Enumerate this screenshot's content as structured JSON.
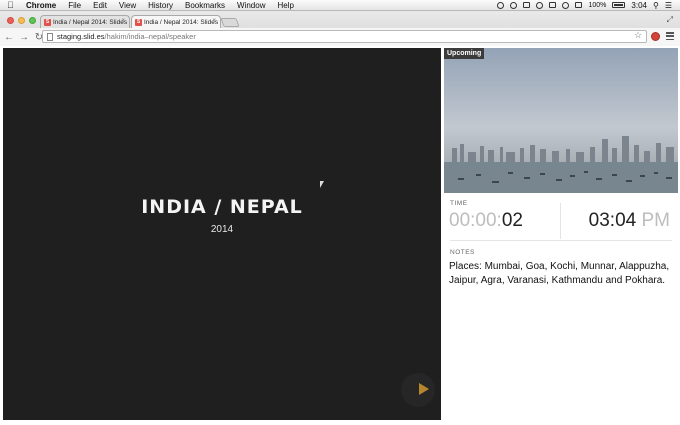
{
  "menubar": {
    "items": [
      "Chrome",
      "File",
      "Edit",
      "View",
      "History",
      "Bookmarks",
      "Window",
      "Help"
    ],
    "battery": "100%",
    "time": "3:04"
  },
  "tabs": [
    {
      "title": "India / Nepal 2014: Slides",
      "favicon": "S"
    },
    {
      "title": "India / Nepal 2014: Slides",
      "favicon": "S"
    }
  ],
  "address": {
    "host": "staging.slid.es",
    "path": "/hakim/india–nepal/speaker"
  },
  "slide": {
    "title": "INDIA / NEPAL",
    "subtitle": "2014"
  },
  "preview": {
    "label": "Upcoming"
  },
  "time": {
    "label": "TIME",
    "elapsed_prefix": "00:00:",
    "elapsed_seconds": "02",
    "clock": "03:04",
    "ampm": "PM"
  },
  "notes": {
    "label": "NOTES",
    "text": "Places: Mumbai, Goa, Kochi, Munnar, Alappuzha, Jaipur, Agra, Varanasi, Kathmandu and Pokhara."
  },
  "colors": {
    "slide_bg": "#1f1f1f",
    "accent_arrow": "#b8852f",
    "favicon": "#e0524a"
  }
}
